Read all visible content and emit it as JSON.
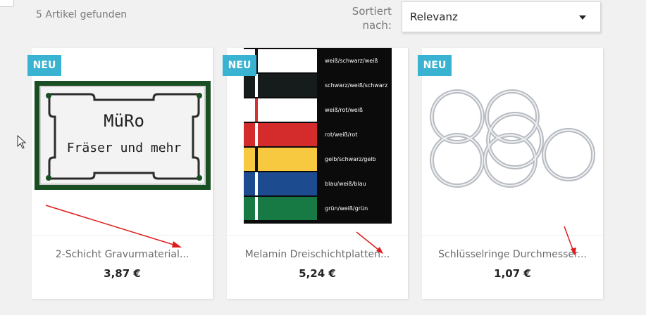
{
  "header": {
    "result_count": "5 Artikel gefunden",
    "sort_label": "Sortiert nach:",
    "sort_selected": "Relevanz",
    "sort_caret_icon": "caret-down-icon"
  },
  "products": [
    {
      "badge": "NEU",
      "name": "2-Schicht Gravurmaterial...",
      "price": "3,87 €",
      "image": "engraving-sign-image",
      "sign_text_line1": "MüRo",
      "sign_text_line2": "Fräser und mehr"
    },
    {
      "badge": "NEU",
      "name": "Melamin Dreischichtplatten...",
      "price": "5,24 €",
      "image": "color-swatches-image",
      "swatches": [
        {
          "label": "weiß/schwarz/weiß",
          "outer": "#ffffff",
          "core": "#111111"
        },
        {
          "label": "schwarz/weiß/schwarz",
          "outer": "#161b1b",
          "core": "#ffffff"
        },
        {
          "label": "weiß/rot/weiß",
          "outer": "#ffffff",
          "core": "#d63030"
        },
        {
          "label": "rot/weiß/rot",
          "outer": "#d42c2c",
          "core": "#ffffff"
        },
        {
          "label": "gelb/schwarz/gelb",
          "outer": "#f6c940",
          "core": "#111111"
        },
        {
          "label": "blau/weiß/blau",
          "outer": "#1c4c8f",
          "core": "#ffffff"
        },
        {
          "label": "grün/weiß/grün",
          "outer": "#177a45",
          "core": "#ffffff"
        }
      ]
    },
    {
      "badge": "NEU",
      "name": "Schlüsselringe Durchmesser...",
      "price": "1,07 €",
      "image": "key-rings-image"
    }
  ],
  "colors": {
    "badge": "#3ab2d1",
    "annotation_arrow": "#e01b1b",
    "page_background": "#f1f1f1"
  }
}
